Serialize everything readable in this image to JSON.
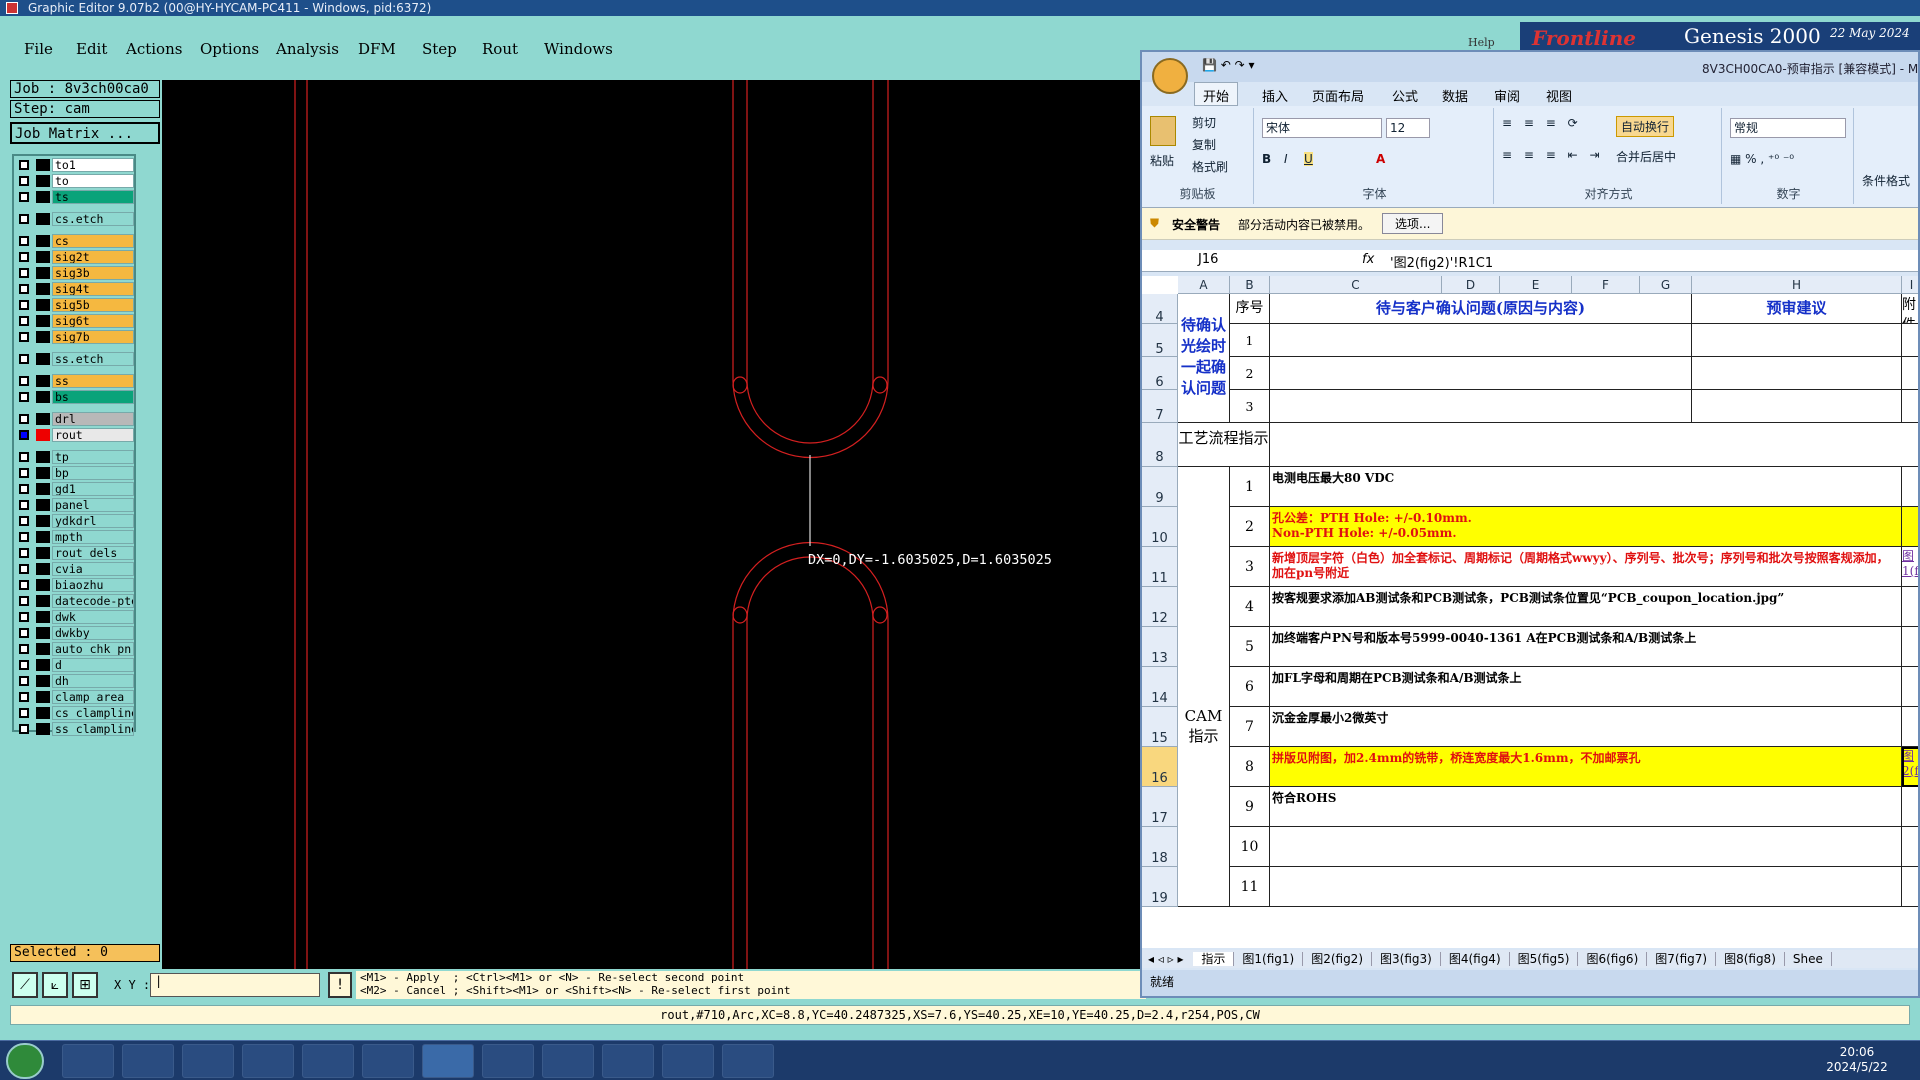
{
  "window": {
    "title": "Graphic Editor 9.07b2 (00@HY-HYCAM-PC411 - Windows, pid:6372)"
  },
  "menu": [
    "File",
    "Edit",
    "Actions",
    "Options",
    "Analysis",
    "DFM",
    "Step",
    "Rout",
    "Windows"
  ],
  "job": {
    "job_label": "Job : 8v3ch00ca0",
    "step_label": "Step: cam",
    "matrix_button": "Job Matrix ..."
  },
  "layers": [
    {
      "name": "to1",
      "color": "#ffffff"
    },
    {
      "name": "to",
      "color": "#ffffff"
    },
    {
      "name": "ts",
      "color": "#0aa37a"
    },
    {
      "name": "cs.etch",
      "color": "#8fd8d0"
    },
    {
      "name": "cs",
      "color": "#f5b840"
    },
    {
      "name": "sig2t",
      "color": "#f5b840"
    },
    {
      "name": "sig3b",
      "color": "#f5b840"
    },
    {
      "name": "sig4t",
      "color": "#f5b840"
    },
    {
      "name": "sig5b",
      "color": "#f5b840"
    },
    {
      "name": "sig6t",
      "color": "#f5b840"
    },
    {
      "name": "sig7b",
      "color": "#f5b840"
    },
    {
      "name": "ss.etch",
      "color": "#8fd8d0"
    },
    {
      "name": "ss",
      "color": "#f5b840"
    },
    {
      "name": "bs",
      "color": "#0aa37a"
    },
    {
      "name": "drl",
      "color": "#b8b8b8"
    },
    {
      "name": "rout",
      "color": "#e8e8e8"
    },
    {
      "name": "tp",
      "color": "#8fd8d0"
    },
    {
      "name": "bp",
      "color": "#8fd8d0"
    },
    {
      "name": "gd1",
      "color": "#8fd8d0"
    },
    {
      "name": "panel",
      "color": "#8fd8d0"
    },
    {
      "name": "ydkdrl",
      "color": "#8fd8d0"
    },
    {
      "name": "mpth",
      "color": "#8fd8d0"
    },
    {
      "name": "rout_dels",
      "color": "#8fd8d0"
    },
    {
      "name": "cvia",
      "color": "#8fd8d0"
    },
    {
      "name": "biaozhu",
      "color": "#8fd8d0"
    },
    {
      "name": "datecode-pte",
      "color": "#8fd8d0"
    },
    {
      "name": "dwk",
      "color": "#8fd8d0"
    },
    {
      "name": "dwkby",
      "color": "#8fd8d0"
    },
    {
      "name": "auto_chk_pn",
      "color": "#8fd8d0"
    },
    {
      "name": "d",
      "color": "#8fd8d0"
    },
    {
      "name": "dh",
      "color": "#8fd8d0"
    },
    {
      "name": "clamp_area",
      "color": "#8fd8d0"
    },
    {
      "name": "cs_clampline",
      "color": "#8fd8d0"
    },
    {
      "name": "ss_clampline",
      "color": "#8fd8d0"
    }
  ],
  "selected_text": "Selected : 0",
  "measure_text": "DX=0,DY=-1.6035025,D=1.6035025",
  "xy_label": "X Y :",
  "hint_line1": "<M1> - Apply  ; <Ctrl><M1> or <N> - Re-select second point",
  "hint_line2": "<M2> - Cancel ; <Shift><M1> or <Shift><N> - Re-select first point",
  "status_line": "rout,#710,Arc,XC=8.8,YC=40.2487325,XS=7.6,YS=40.25,XE=10,YE=40.25,D=2.4,r254,POS,CW",
  "genesis": {
    "brand": "Frontline",
    "product": "Genesis 2000",
    "date": "22 May 2024",
    "help": "Help"
  },
  "excel": {
    "title": "8V3CH00CA0-预审指示 [兼容模式] - M",
    "tabs": [
      "开始",
      "插入",
      "页面布局",
      "公式",
      "数据",
      "审阅",
      "视图"
    ],
    "clip": {
      "paste": "粘贴",
      "cut": "剪切",
      "copy": "复制",
      "format": "格式刷",
      "group": "剪贴板"
    },
    "font": {
      "name": "宋体",
      "size": "12",
      "group": "字体"
    },
    "align": {
      "wrap": "自动换行",
      "merge": "合并后居中",
      "group": "对齐方式"
    },
    "number": {
      "format": "常规",
      "group": "数字"
    },
    "cond": "条件格式",
    "security": {
      "label": "安全警告",
      "text": "部分活动内容已被禁用。",
      "button": "选项..."
    },
    "namebox": "J16",
    "formula": "'图2(fig2)'!R1C1",
    "columns": [
      "A",
      "B",
      "C",
      "D",
      "E",
      "F",
      "G",
      "H",
      "I"
    ],
    "header": {
      "seq": "序号",
      "issue": "待与客户确认问题(原因与内容)",
      "advice": "预审建议",
      "attach": "附件"
    },
    "confirm_label": "待确认光绘时一起确认问题",
    "flow_label": "工艺流程指示",
    "cam_label": "CAM指示",
    "rows": [
      {
        "r": "4"
      },
      {
        "r": "5"
      },
      {
        "r": "6"
      },
      {
        "r": "7"
      },
      {
        "r": "8"
      },
      {
        "r": "9"
      },
      {
        "r": "10"
      },
      {
        "r": "11"
      },
      {
        "r": "12"
      },
      {
        "r": "13"
      },
      {
        "r": "14"
      },
      {
        "r": "15"
      },
      {
        "r": "16"
      },
      {
        "r": "17"
      },
      {
        "r": "18"
      },
      {
        "r": "19"
      }
    ],
    "confirm_items": [
      "1",
      "2",
      "3"
    ],
    "cam_items": [
      {
        "n": "1",
        "text": "电测电压最大80 VDC",
        "hl": false,
        "attach": ""
      },
      {
        "n": "2",
        "text": "孔公差：PTH Hole: +/-0.10mm.\nNon-PTH Hole: +/-0.05mm.",
        "hl": true,
        "attach": ""
      },
      {
        "n": "3",
        "text": "新增顶层字符（白色）加全套标记、周期标记（周期格式wwyy）、序列号、批次号；序列号和批次号按照客规添加，加在pn号附近",
        "hl": false,
        "red": true,
        "attach": "图1(fi"
      },
      {
        "n": "4",
        "text": "按客规要求添加AB测试条和PCB测试条，PCB测试条位置见“PCB_coupon_location.jpg”",
        "hl": false,
        "attach": ""
      },
      {
        "n": "5",
        "text": "加终端客户PN号和版本号5999-0040-1361 A在PCB测试条和A/B测试条上",
        "hl": false,
        "attach": ""
      },
      {
        "n": "6",
        "text": "加FL字母和周期在PCB测试条和A/B测试条上",
        "hl": false,
        "attach": ""
      },
      {
        "n": "7",
        "text": "沉金金厚最小2微英寸",
        "hl": false,
        "attach": ""
      },
      {
        "n": "8",
        "text": "拼版见附图，加2.4mm的铣带，桥连宽度最大1.6mm，不加邮票孔",
        "hl": true,
        "attach": "图2(fig"
      },
      {
        "n": "9",
        "text": "符合ROHS",
        "hl": false,
        "attach": ""
      },
      {
        "n": "10",
        "text": "",
        "hl": false,
        "attach": ""
      },
      {
        "n": "11",
        "text": "",
        "hl": false,
        "attach": ""
      }
    ],
    "sheets": [
      "指示",
      "图1(fig1)",
      "图2(fig2)",
      "图3(fig3)",
      "图4(fig4)",
      "图5(fig5)",
      "图6(fig6)",
      "图7(fig7)",
      "图8(fig8)",
      "Shee"
    ],
    "status": "就绪"
  },
  "tray": {
    "time": "20:06",
    "date": "2024/5/22"
  }
}
